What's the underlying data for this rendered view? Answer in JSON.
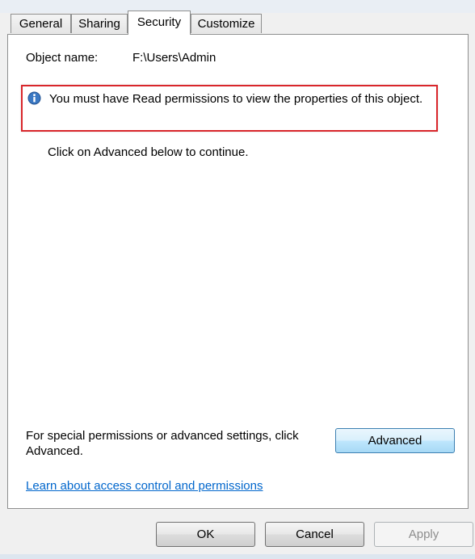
{
  "tabs": [
    {
      "label": "General"
    },
    {
      "label": "Sharing"
    },
    {
      "label": "Security",
      "active": true
    },
    {
      "label": "Customize"
    }
  ],
  "security": {
    "object_name_label": "Object name:",
    "object_name_value": "F:\\Users\\Admin",
    "info_message": "You must have Read permissions to view the properties of this object.",
    "continue_text": "Click on Advanced below to continue.",
    "special_permissions_text": "For special permissions or advanced settings, click Advanced.",
    "advanced_button": "Advanced",
    "help_link": "Learn about access control and permissions"
  },
  "dialog_buttons": {
    "ok": "OK",
    "cancel": "Cancel",
    "apply": "Apply",
    "apply_disabled": true
  },
  "colors": {
    "highlight_border": "#d9262b",
    "link": "#0066cc",
    "info_icon": "#3a78c3"
  }
}
